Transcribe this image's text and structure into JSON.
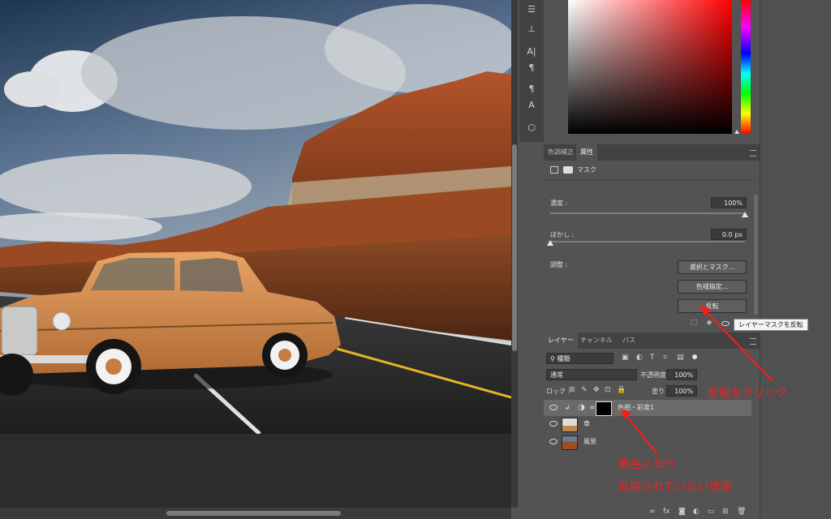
{
  "properties_panel": {
    "tab_adjustments": "色調補正",
    "tab_properties": "属性",
    "mask_label": "マスク",
    "density_label": "濃度 :",
    "density_value": "100%",
    "density_fraction": 1.0,
    "feather_label": "ぼかし :",
    "feather_value": "0.0 px",
    "feather_fraction": 0.0,
    "refine_label": "調整 :",
    "select_mask_button": "選択とマスク...",
    "color_range_button": "色域指定...",
    "invert_button": "反転",
    "tooltip": "レイヤーマスクを反転"
  },
  "layers_panel": {
    "tab_layers": "レイヤー",
    "tab_channels": "チャンネル",
    "tab_paths": "パス",
    "filter_kind": "種類",
    "blend_mode": "通常",
    "opacity_label": "不透明度 :",
    "opacity_value": "100%",
    "lock_label": "ロック :",
    "fill_label": "塗り :",
    "fill_value": "100%",
    "layers": [
      {
        "name": "色相・彩度1"
      },
      {
        "name": "車"
      },
      {
        "name": "風景"
      }
    ],
    "footer_fx": "fx"
  },
  "annotations": {
    "click_invert": "反転をクリック",
    "black_line1": "黒色になり",
    "black_line2": "反映されていない状態"
  },
  "colors": {
    "annotation_red": "#ff1a1a",
    "panel_bg": "#535353",
    "panel_dark": "#424242"
  },
  "icons": {
    "visibility": "eye-icon",
    "adjustment": "half-circle-icon",
    "link": "chain-icon"
  }
}
